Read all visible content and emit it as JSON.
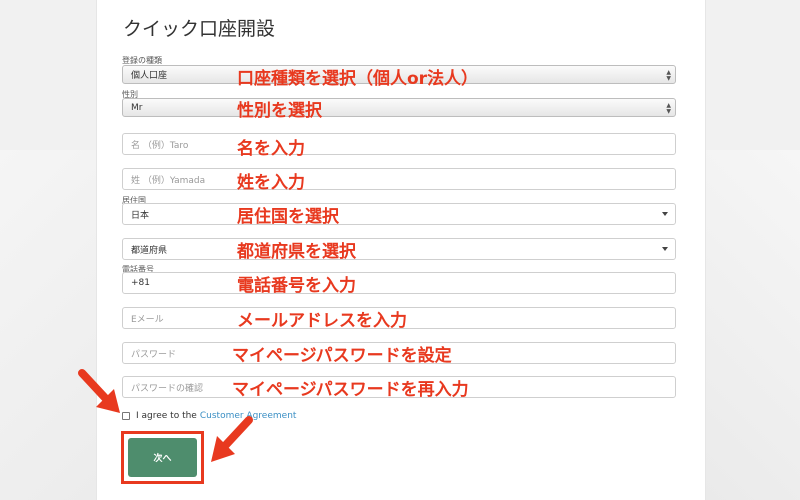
{
  "form": {
    "title": "クイック口座開設",
    "account_type_label": "登録の種類",
    "account_type_value": "個人口座",
    "gender_label": "性別",
    "gender_value": "Mr",
    "first_name_placeholder": "名 （例）Taro",
    "last_name_placeholder": "姓 （例）Yamada",
    "country_label": "居住国",
    "country_value": "日本",
    "prefecture_value": "都道府県",
    "phone_label": "電話番号",
    "phone_value": "+81",
    "email_placeholder": "Eメール",
    "password_placeholder": "パスワード",
    "password_confirm_placeholder": "パスワードの確認",
    "agree_text": "I agree to the",
    "agree_link": "Customer Agreement",
    "next_button": "次へ"
  },
  "annotations": {
    "account_type": "口座種類を選択（個人or法人）",
    "gender": "性別を選択",
    "first_name": "名を入力",
    "last_name": "姓を入力",
    "country": "居住国を選択",
    "prefecture": "都道府県を選択",
    "phone": "電話番号を入力",
    "email": "メールアドレスを入力",
    "password": "マイページパスワードを設定",
    "password_confirm": "マイページパスワードを再入力"
  },
  "colors": {
    "annotation": "#e8391f",
    "button": "#4e8d6d",
    "link": "#3b8fc4"
  }
}
